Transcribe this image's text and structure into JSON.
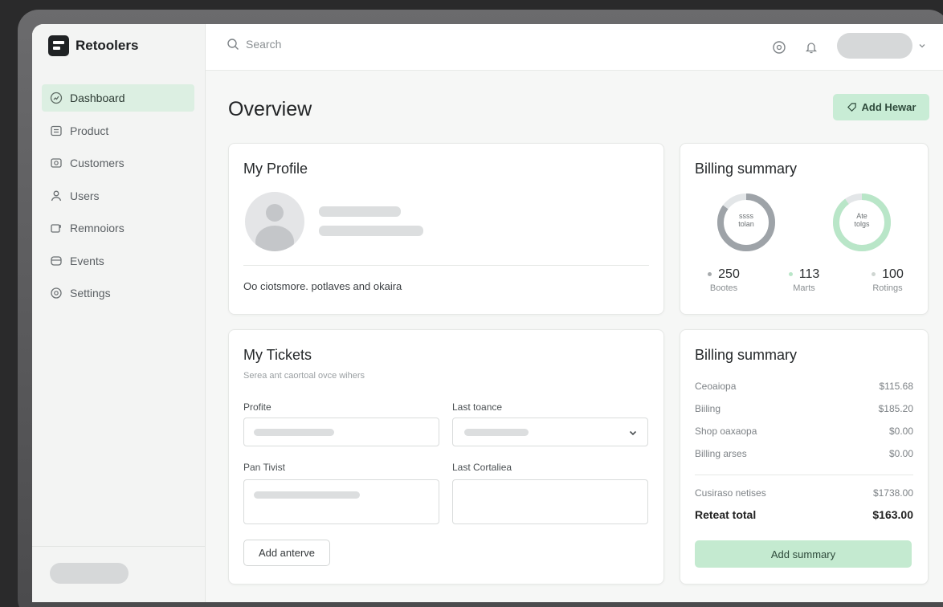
{
  "app": {
    "name": "Retoolers"
  },
  "sidebar": {
    "items": [
      {
        "label": "Dashboard",
        "icon": "dashboard-icon",
        "active": true
      },
      {
        "label": "Product",
        "icon": "product-icon",
        "active": false
      },
      {
        "label": "Customers",
        "icon": "customers-icon",
        "active": false
      },
      {
        "label": "Users",
        "icon": "users-icon",
        "active": false
      },
      {
        "label": "Remnoiors",
        "icon": "reminders-icon",
        "active": false
      },
      {
        "label": "Events",
        "icon": "events-icon",
        "active": false
      },
      {
        "label": "Settings",
        "icon": "settings-icon",
        "active": false
      }
    ]
  },
  "search": {
    "placeholder": "Search"
  },
  "header": {
    "title": "Overview",
    "add_button": "Add Hewar"
  },
  "profile": {
    "title": "My Profile",
    "description": "Oo ciotsmore. potlaves and okaira"
  },
  "tickets": {
    "title": "My Tickets",
    "subtitle": "Serea ant caortoal ovce wihers",
    "fields": {
      "profile_label": "Profite",
      "last_label": "Last toance",
      "pass_label": "Pan Tivist",
      "contact_label": "Last Cortaliea"
    },
    "add_button": "Add anterve"
  },
  "billing_summary": {
    "title": "Billing summary",
    "donut1": {
      "line1": "ssss",
      "line2": "tolan",
      "fraction": 0.85,
      "color": "#9ea3a8"
    },
    "donut2": {
      "line1": "Ate",
      "line2": "tolgs",
      "fraction": 0.9,
      "color": "#b9e6c8"
    },
    "stats": [
      {
        "value": "250",
        "label": "Bootes",
        "color": "#a7abad"
      },
      {
        "value": "113",
        "label": "Marts",
        "color": "#b9e6c8"
      },
      {
        "value": "100",
        "label": "Rotings",
        "color": "#cfd6d2"
      }
    ]
  },
  "billing_table": {
    "title": "Billing summary",
    "rows": [
      {
        "label": "Ceoaiopa",
        "value": "$115.68"
      },
      {
        "label": "Biiling",
        "value": "$185.20"
      },
      {
        "label": "Shop oaxaopa",
        "value": "$0.00"
      },
      {
        "label": "Billing arses",
        "value": "$0.00"
      }
    ],
    "subtotal": {
      "label": "Cusiraso netises",
      "value": "$1738.00"
    },
    "total": {
      "label": "Reteat total",
      "value": "$163.00"
    },
    "button": "Add summary"
  }
}
